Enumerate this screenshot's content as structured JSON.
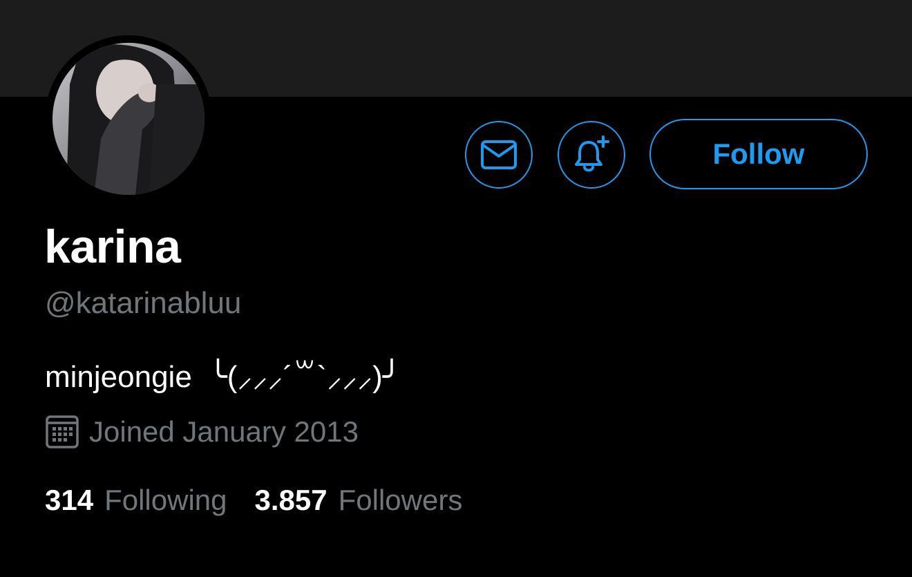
{
  "profile": {
    "display_name": "karina",
    "handle": "@katarinabluu",
    "bio": "minjeongie  ╰(⸝⸝⸝´꒳`⸝⸝⸝)╯",
    "joined": "Joined January 2013",
    "avatar": "profile-photo"
  },
  "actions": {
    "message_icon": "envelope-icon",
    "notify_icon": "bell-plus-icon",
    "follow_label": "Follow"
  },
  "stats": {
    "following_count": "314",
    "following_label": "Following",
    "followers_count": "3.857",
    "followers_label": "Followers"
  },
  "colors": {
    "accent": "#1d9bf0",
    "background": "#000000",
    "banner": "#1c1c1d",
    "muted_text": "#71767b",
    "primary_text": "#ffffff"
  }
}
